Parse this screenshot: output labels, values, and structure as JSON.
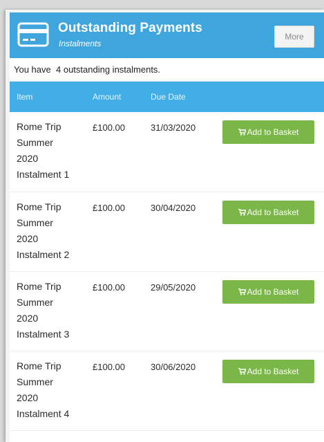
{
  "header": {
    "title": "Outstanding Payments",
    "subtitle": "Instalments",
    "more_label": "More"
  },
  "summary": {
    "prefix": "You have",
    "count": "4",
    "suffix": "outstanding instalments."
  },
  "table": {
    "columns": [
      "Item",
      "Amount",
      "Due Date",
      ""
    ],
    "rows": [
      {
        "item": [
          "Rome Trip",
          "Summer",
          "2020",
          "Instalment 1"
        ],
        "amount": "£100.00",
        "due": "31/03/2020",
        "action": "Add to Basket"
      },
      {
        "item": [
          "Rome Trip",
          "Summer",
          "2020",
          "Instalment 2"
        ],
        "amount": "£100.00",
        "due": "30/04/2020",
        "action": "Add to Basket"
      },
      {
        "item": [
          "Rome Trip",
          "Summer",
          "2020",
          "Instalment 3"
        ],
        "amount": "£100.00",
        "due": "29/05/2020",
        "action": "Add to Basket"
      },
      {
        "item": [
          "Rome Trip",
          "Summer",
          "2020",
          "Instalment 4"
        ],
        "amount": "£100.00",
        "due": "30/06/2020",
        "action": "Add to Basket"
      }
    ]
  },
  "icons": {
    "header": "credit-card-icon",
    "button": "cart-icon"
  },
  "colors": {
    "header_bg": "#3ea6dc",
    "table_header_bg": "#41aee5",
    "button_bg": "#7ab648"
  }
}
